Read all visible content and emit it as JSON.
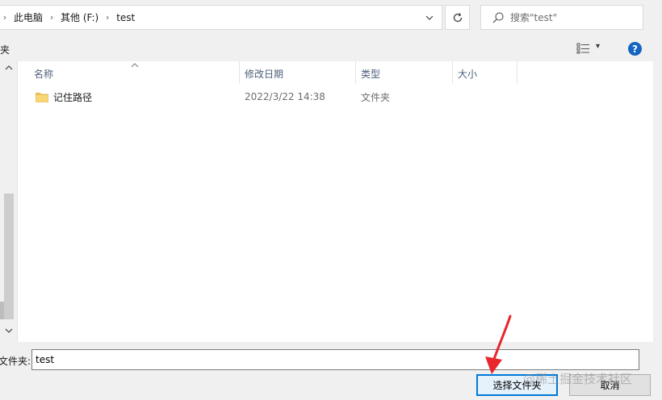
{
  "address": {
    "crumbs": [
      "此电脑",
      "其他 (F:)",
      "test"
    ],
    "dropdown_glyph": "⌄",
    "refresh_glyph": "↻"
  },
  "search": {
    "placeholder": "搜索\"test\""
  },
  "toolbar": {
    "left_label": "夹",
    "view_dropdown_glyph": "▾",
    "help_glyph": "?"
  },
  "columns": {
    "name": "名称",
    "date": "修改日期",
    "type": "类型",
    "size": "大小"
  },
  "rows": [
    {
      "name": "记住路径",
      "date": "2022/3/22 14:38",
      "type": "文件夹",
      "size": ""
    }
  ],
  "bottom": {
    "folder_label": "文件夹:",
    "folder_value": "test",
    "select_button": "选择文件夹",
    "cancel_button": "取消",
    "watermark": "@稀土掘金技术社区"
  },
  "colors": {
    "accent": "#0078d7",
    "help": "#1565c0",
    "folder": "#f2c55c",
    "arrow": "#e8262c"
  }
}
